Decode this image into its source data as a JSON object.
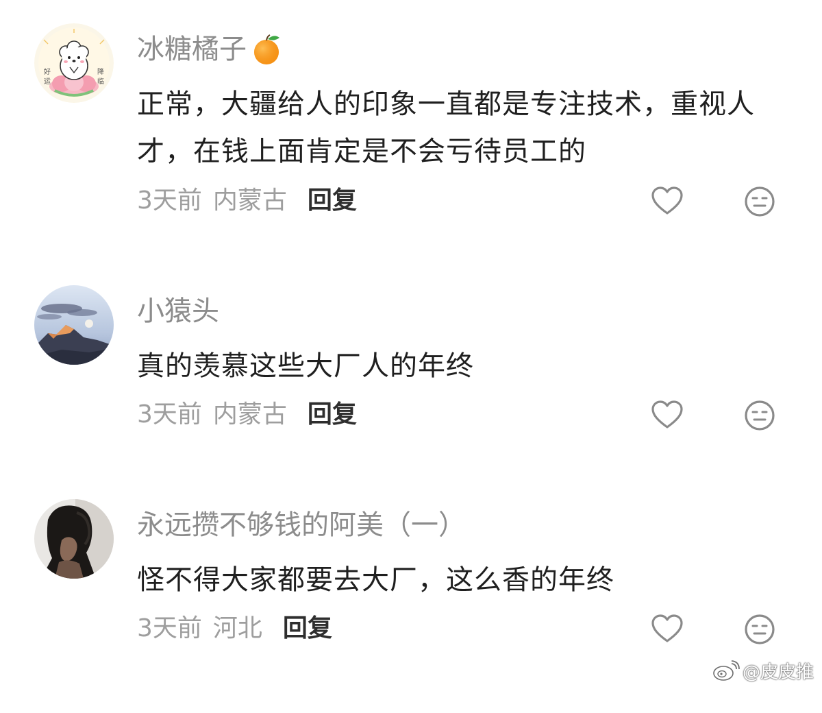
{
  "comments": [
    {
      "username": "冰糖橘子",
      "username_emoji": "tangerine-emoji",
      "text": "正常，大疆给人的印象一直都是专注技术，重视人才，在钱上面肯定是不会亏待员工的",
      "time": "3天前",
      "location": "内蒙古",
      "reply_label": "回复",
      "avatar": "puppy-cartoon-avatar"
    },
    {
      "username": "小猿头",
      "text": "真的羡慕这些大厂人的年终",
      "time": "3天前",
      "location": "内蒙古",
      "reply_label": "回复",
      "avatar": "mountain-moon-photo-avatar"
    },
    {
      "username": "永远攒不够钱的阿美（一）",
      "text": "怪不得大家都要去大厂，这么香的年终",
      "time": "3天前",
      "location": "河北",
      "reply_label": "回复",
      "avatar": "dark-portrait-photo-avatar"
    }
  ],
  "icons": {
    "like": "heart-outline-icon",
    "dislike": "neutral-face-icon",
    "watermark": "weibo-logo-icon"
  },
  "watermark": {
    "text": "@皮皮推"
  },
  "colors": {
    "username": "#8c8c8c",
    "content": "#1f1f1f",
    "meta": "#9e9e9e",
    "reply": "#2e2e2e",
    "icon": "#8a8a8a"
  }
}
